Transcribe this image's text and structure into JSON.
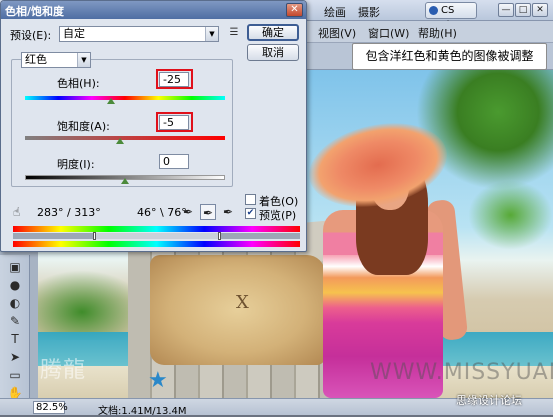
{
  "ps_menu": {
    "items": [
      "绘画",
      "摄影",
      "视图(V)",
      "窗口(W)",
      "帮助(H)"
    ],
    "cs_live": "CS Live",
    "window_buttons": [
      "—",
      "□",
      "✕"
    ]
  },
  "callout": {
    "text": "包含洋红色和黄色的图像被调整"
  },
  "dialog": {
    "title": "色相/饱和度",
    "preset_label": "预设(E):",
    "preset_value": "自定",
    "ok_label": "确定",
    "cancel_label": "取消",
    "channel_value": "红色",
    "hue": {
      "label": "色相(H):",
      "value": "-25",
      "position": -25,
      "min": -180,
      "max": 180
    },
    "saturation": {
      "label": "饱和度(A):",
      "value": "-5",
      "position": -5,
      "min": -100,
      "max": 100
    },
    "lightness": {
      "label": "明度(I):",
      "value": "0",
      "position": 0,
      "min": -100,
      "max": 100
    },
    "colorize_label": "着色(O)",
    "colorize_checked": false,
    "preview_label": "预览(P)",
    "preview_checked": true,
    "range_left": "283° / 313°",
    "range_right": "46° \\ 76°"
  },
  "status": {
    "zoom": "82.5%",
    "doc": "文档:1.41M/13.4M"
  },
  "watermark": {
    "left": "腾龍",
    "right": "WWW.MISSYUAN.NET",
    "site": "思缘设计论坛"
  },
  "colors": {
    "highlight": "#e0101a",
    "title_bar": "#4f6ea3",
    "dialog_bg": "#dfe5ee"
  }
}
